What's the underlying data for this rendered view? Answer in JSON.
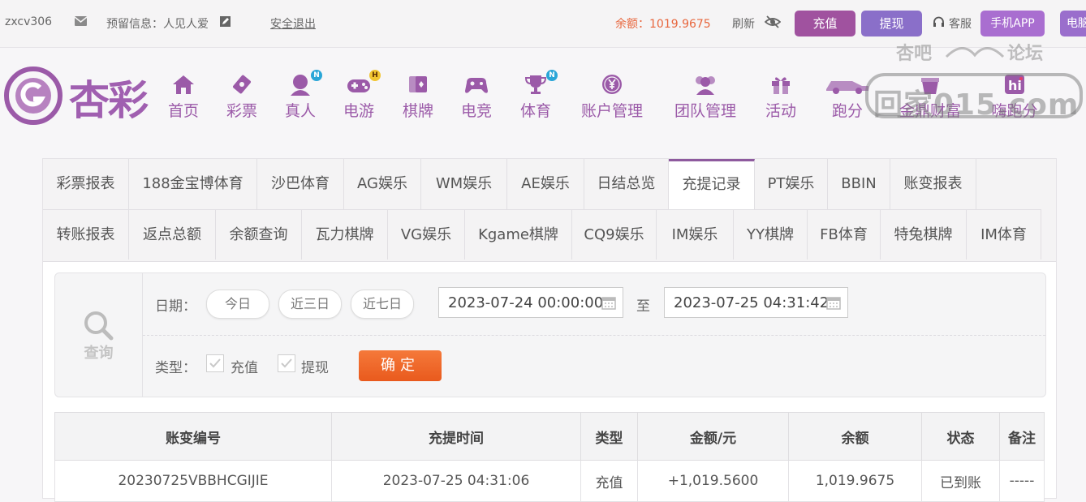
{
  "topbar": {
    "username": "zxcv306",
    "reserved_label": "预留信息：人见人爱",
    "logout": "安全退出",
    "balance": "余额：1019.9675",
    "refresh": "刷新",
    "recharge": "充值",
    "withdraw": "提现",
    "service": "客服",
    "mobile_app": "手机APP",
    "pc_partial": "电脑"
  },
  "nav": {
    "logo_text": "杏彩",
    "items": [
      {
        "label": "首页",
        "icon": "home-icon"
      },
      {
        "label": "彩票",
        "icon": "lottery-icon"
      },
      {
        "label": "真人",
        "icon": "live-dealer-icon",
        "badge": "N"
      },
      {
        "label": "电游",
        "icon": "gamepad-icon",
        "badge": "H"
      },
      {
        "label": "棋牌",
        "icon": "cards-icon"
      },
      {
        "label": "电竞",
        "icon": "controller-icon"
      },
      {
        "label": "体育",
        "icon": "trophy-icon",
        "badge": "N"
      },
      {
        "label": "账户管理",
        "icon": "yen-coin-icon"
      },
      {
        "label": "团队管理",
        "icon": "team-icon"
      },
      {
        "label": "活动",
        "icon": "gift-icon"
      },
      {
        "label": "跑分",
        "icon": "car-icon"
      },
      {
        "label": "金鼎财富",
        "icon": "wealth-icon"
      },
      {
        "label": "嗨跑分",
        "icon": "hi-icon"
      }
    ]
  },
  "watermark": {
    "line1_left": "杏吧",
    "line1_right": "论坛",
    "line2": "回家015.com"
  },
  "tabs": {
    "row1": [
      "彩票报表",
      "188金宝博体育",
      "沙巴体育",
      "AG娱乐",
      "WM娱乐",
      "AE娱乐",
      "日结总览",
      "充提记录",
      "PT娱乐",
      "BBIN",
      "账变报表"
    ],
    "row2": [
      "转账报表",
      "返点总额",
      "余额查询",
      "瓦力棋牌",
      "VG娱乐",
      "Kgame棋牌",
      "CQ9娱乐",
      "IM娱乐",
      "YY棋牌",
      "FB体育",
      "特兔棋牌",
      "IM体育"
    ],
    "active": "充提记录"
  },
  "query": {
    "icon_label": "查询",
    "date_label": "日期：",
    "quick": [
      "今日",
      "近三日",
      "近七日"
    ],
    "start": "2023-07-24 00:00:00",
    "to": "至",
    "end": "2023-07-25 04:31:42",
    "type_label": "类型：",
    "types": [
      "充值",
      "提现"
    ],
    "confirm": "确定"
  },
  "table": {
    "headers": [
      "账变编号",
      "充提时间",
      "类型",
      "金额/元",
      "余额",
      "状态",
      "备注"
    ],
    "rows": [
      [
        "20230725VBBHCGIJIE",
        "2023-07-25 04:31:06",
        "充值",
        "+1,019.5600",
        "1,019.9675",
        "已到账",
        "-----"
      ]
    ]
  },
  "colors": {
    "brand": "#9b5aa8",
    "accent": "#f06a2a",
    "amount": "#d9232a",
    "status_ok": "#2f9e2f"
  }
}
